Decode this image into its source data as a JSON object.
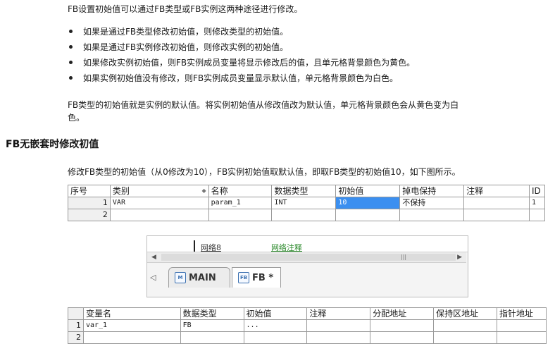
{
  "intro": "FB设置初始值可以通过FB类型或FB实例这两种途径进行修改。",
  "bullets": [
    "如果是通过FB类型修改初始值，则修改类型的初始值。",
    "如果是通过FB实例修改初始值，则修改实例的初始值。",
    "如果修改实例初始值，则FB实例成员变量将显示修改后的值，且单元格背景颜色为黄色。",
    "如果实例初始值没有修改，则FB实例成员变量显示默认值，单元格背景颜色为白色。"
  ],
  "note_line1": "FB类型的初始值就是实例的默认值。将实例初始值从修改值改为默认值，单元格背景颜色会从黄色变为白",
  "note_line2": "色。",
  "heading": "FB无嵌套时修改初值",
  "desc": "修改FB类型的初始值（从0修改为10），FB实例初始值取默认值，即取FB类型的初始值10，如下图所示。",
  "table1": {
    "headers": [
      "序号",
      "类别",
      "名称",
      "数据类型",
      "初始值",
      "掉电保持",
      "注释",
      "ID"
    ],
    "rows": [
      [
        "1",
        "VAR",
        "param_1",
        "INT",
        "10",
        "不保持",
        "",
        "1"
      ],
      [
        "2",
        "",
        "",
        "",
        "",
        "",
        "",
        ""
      ]
    ]
  },
  "editor": {
    "net_label": "网络8",
    "net_comment": "网络注释",
    "tabs": [
      "MAIN",
      "FB *"
    ]
  },
  "table2": {
    "headers": [
      "",
      "变量名",
      "数据类型",
      "初始值",
      "注释",
      "分配地址",
      "保持区地址",
      "指针地址"
    ],
    "rows": [
      [
        "1",
        "var_1",
        "FB",
        "...",
        "",
        "",
        "",
        ""
      ],
      [
        "2",
        "",
        "",
        "",
        "",
        "",
        "",
        ""
      ]
    ]
  }
}
